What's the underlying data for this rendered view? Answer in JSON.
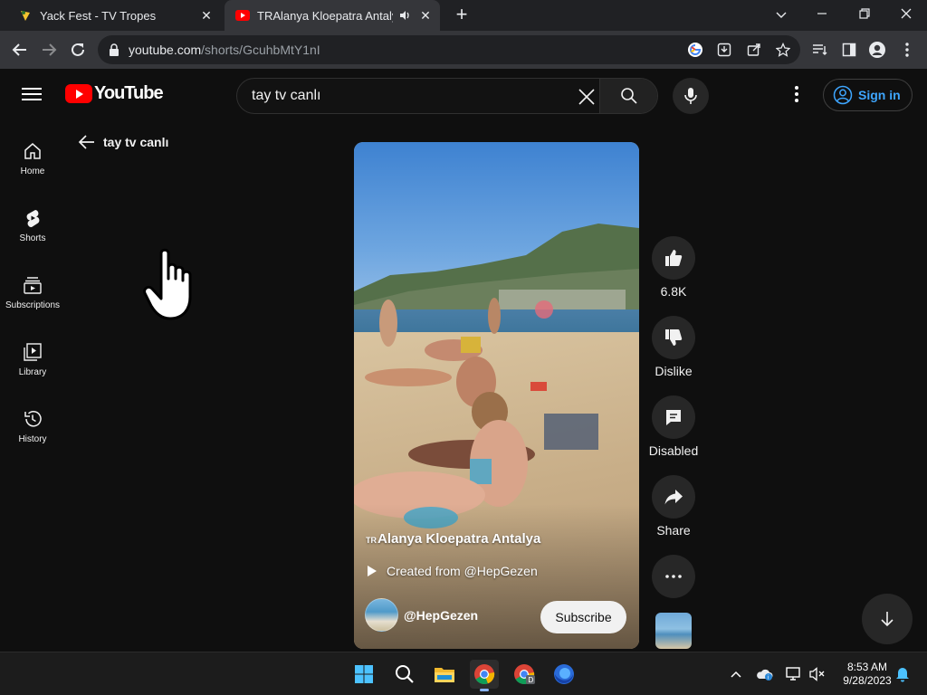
{
  "browser": {
    "tabs": [
      {
        "title": "Yack Fest - TV Tropes",
        "active": false
      },
      {
        "title": "TRAlanya Kloepatra Antalya",
        "active": true
      }
    ],
    "url_host": "youtube.com",
    "url_path": "/shorts/GcuhbMtY1nI"
  },
  "header": {
    "logo_text": "YouTube",
    "search_value": "tay tv canlı",
    "signin_label": "Sign in"
  },
  "sidebar": {
    "items": [
      {
        "label": "Home",
        "icon": "home-icon"
      },
      {
        "label": "Shorts",
        "icon": "shorts-icon"
      },
      {
        "label": "Subscriptions",
        "icon": "subscriptions-icon"
      },
      {
        "label": "Library",
        "icon": "library-icon"
      },
      {
        "label": "History",
        "icon": "history-icon"
      }
    ]
  },
  "back": {
    "label": "tay tv canlı"
  },
  "short": {
    "title_prefix": "TR",
    "title": "Alanya Kloepatra Antalya",
    "created_from": "Created from @HepGezen",
    "channel": "@HepGezen",
    "subscribe_label": "Subscribe"
  },
  "actions": {
    "like_count": "6.8K",
    "dislike_label": "Dislike",
    "comments_label": "Disabled",
    "share_label": "Share"
  },
  "taskbar": {
    "time": "8:53 AM",
    "date": "9/28/2023"
  },
  "colors": {
    "brand_red": "#ff0000",
    "link_blue": "#3ea6ff",
    "background": "#0f0f0f"
  }
}
